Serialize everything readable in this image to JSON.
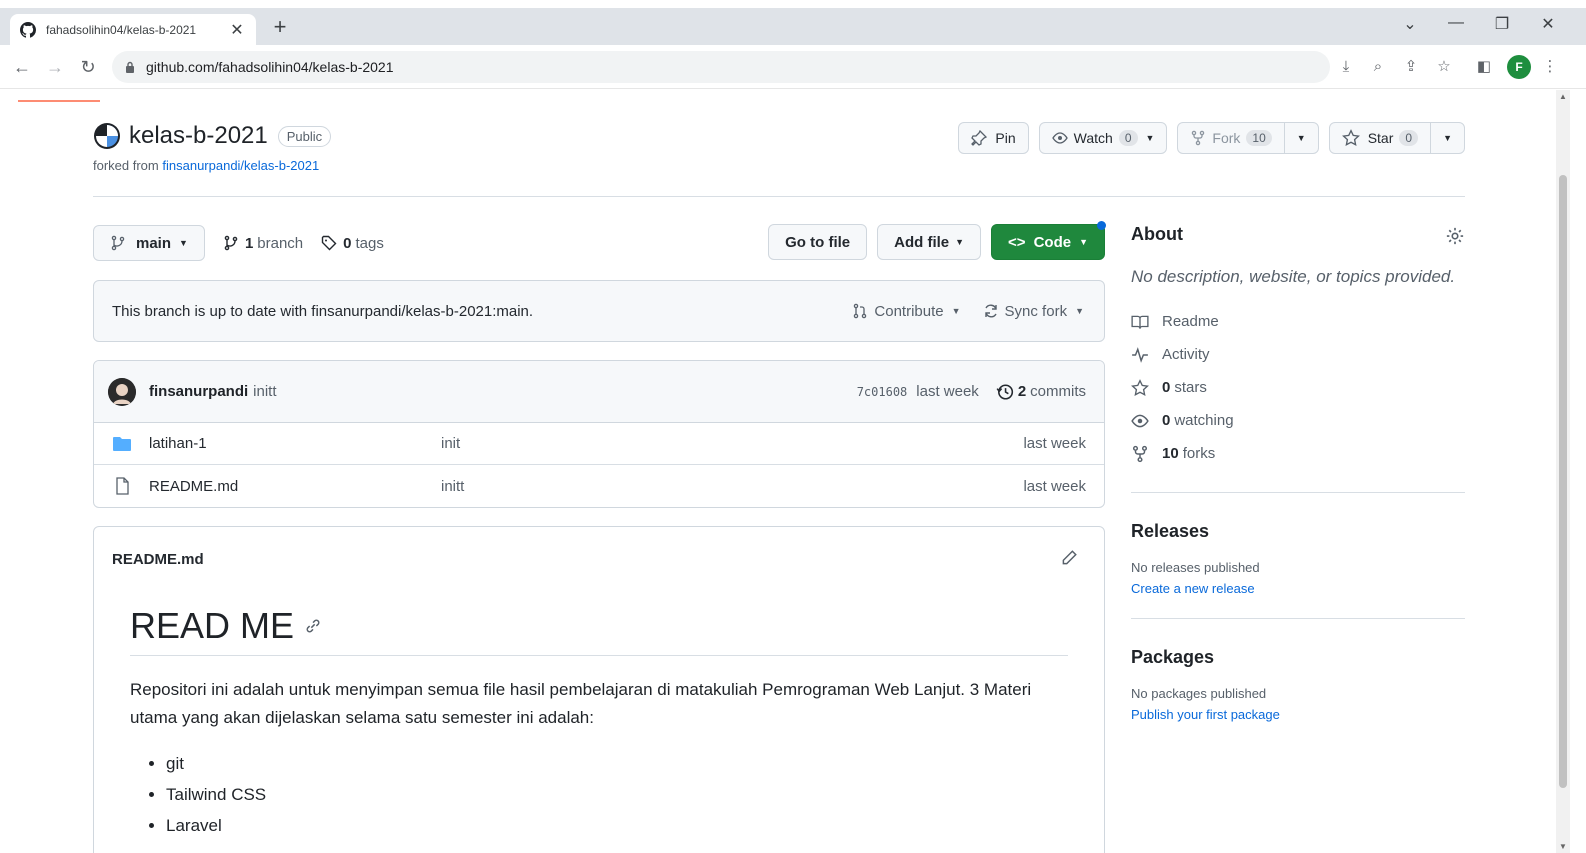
{
  "browser": {
    "tab_title": "fahadsolihin04/kelas-b-2021",
    "tab_close": "✕",
    "new_tab": "+",
    "url": "github.com/fahadsolihin04/kelas-b-2021",
    "profile_initial": "F"
  },
  "repo": {
    "name": "kelas-b-2021",
    "visibility": "Public",
    "forked_prefix": "forked from",
    "forked_link": "finsanurpandi/kelas-b-2021",
    "actions": {
      "pin": "Pin",
      "watch": "Watch",
      "watch_count": "0",
      "fork": "Fork",
      "fork_count": "10",
      "star": "Star",
      "star_count": "0"
    }
  },
  "branch_bar": {
    "branch": "main",
    "branches_count": "1",
    "branches_label": "branch",
    "tags_count": "0",
    "tags_label": "tags",
    "go_to_file": "Go to file",
    "add_file": "Add file",
    "code": "Code"
  },
  "sync": {
    "status": "This branch is up to date with finsanurpandi/kelas-b-2021:main.",
    "contribute": "Contribute",
    "sync_fork": "Sync fork"
  },
  "latest_commit": {
    "author": "finsanurpandi",
    "message": "initt",
    "sha": "7c01608",
    "time": "last week",
    "commits_count": "2",
    "commits_label": "commits"
  },
  "files": [
    {
      "name": "latihan-1",
      "type": "folder",
      "commit": "init",
      "time": "last week"
    },
    {
      "name": "README.md",
      "type": "file",
      "commit": "initt",
      "time": "last week"
    }
  ],
  "readme": {
    "filename": "README.md",
    "heading": "READ ME",
    "paragraph": "Repositori ini adalah untuk menyimpan semua file hasil pembelajaran di matakuliah Pemrograman Web Lanjut. 3 Materi utama yang akan dijelaskan selama satu semester ini adalah:",
    "list": [
      "git",
      "Tailwind CSS",
      "Laravel"
    ]
  },
  "about": {
    "title": "About",
    "description": "No description, website, or topics provided.",
    "readme": "Readme",
    "activity": "Activity",
    "stars_count": "0",
    "stars_label": "stars",
    "watching_count": "0",
    "watching_label": "watching",
    "forks_count": "10",
    "forks_label": "forks"
  },
  "releases": {
    "title": "Releases",
    "empty": "No releases published",
    "link": "Create a new release"
  },
  "packages": {
    "title": "Packages",
    "empty": "No packages published",
    "link": "Publish your first package"
  },
  "colors": {
    "accent_link": "#0969da",
    "code_button": "#1f883d",
    "folder": "#54aeff"
  }
}
